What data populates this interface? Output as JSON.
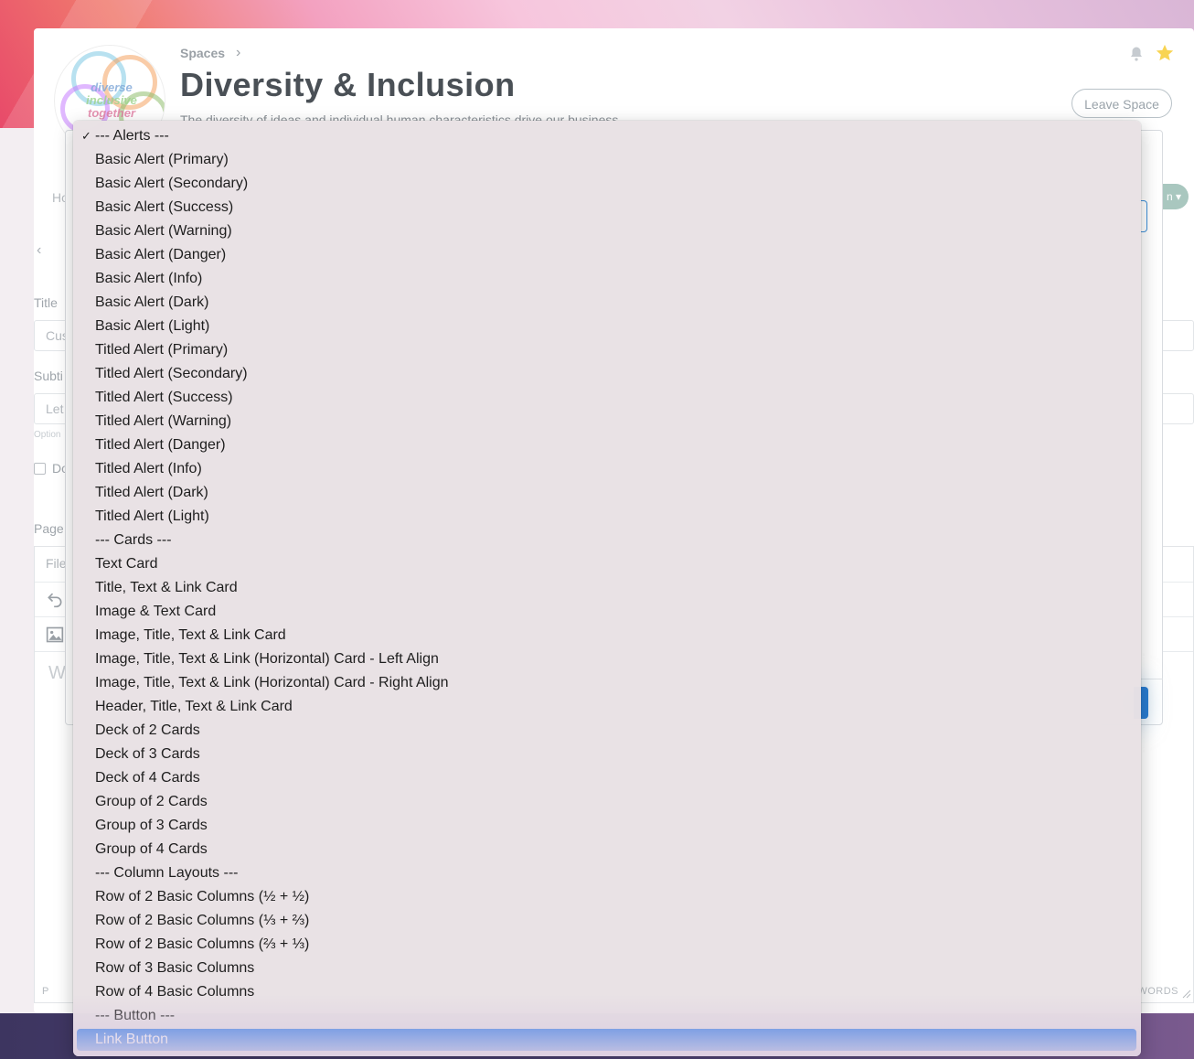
{
  "space": {
    "breadcrumb": "Spaces",
    "title": "Diversity & Inclusion",
    "description": "The diversity of ideas and individual human characteristics drive our business",
    "leave_button": "Leave Space",
    "logo_words": [
      "diverse",
      "inclusive",
      "together"
    ]
  },
  "nav": {
    "home_stub": "Ho",
    "pill_stub": "n ▾"
  },
  "form": {
    "title_label": "Title",
    "title_value": "Cus",
    "subtitle_label": "Subti",
    "subtitle_value": "Let",
    "optional_note": "Option",
    "checkbox_label": "Do",
    "page_label": "Page"
  },
  "editor": {
    "file_menu": "File",
    "placeholder": "W",
    "status_path": "P",
    "words_label": "WORDS"
  },
  "dropdown": {
    "checked_index": 0,
    "selected_index": 38,
    "options": [
      "--- Alerts ---",
      "Basic Alert (Primary)",
      "Basic Alert (Secondary)",
      "Basic Alert (Success)",
      "Basic Alert (Warning)",
      "Basic Alert (Danger)",
      "Basic Alert (Info)",
      "Basic Alert (Dark)",
      "Basic Alert (Light)",
      "Titled Alert (Primary)",
      "Titled Alert (Secondary)",
      "Titled Alert (Success)",
      "Titled Alert (Warning)",
      "Titled Alert (Danger)",
      "Titled Alert (Info)",
      "Titled Alert (Dark)",
      "Titled Alert (Light)",
      "--- Cards ---",
      "Text Card",
      "Title, Text & Link Card",
      "Image & Text Card",
      "Image, Title, Text & Link Card",
      "Image, Title, Text & Link (Horizontal) Card - Left Align",
      "Image, Title, Text & Link (Horizontal) Card - Right Align",
      "Header, Title, Text & Link Card",
      "Deck of 2 Cards",
      "Deck of 3 Cards",
      "Deck of 4 Cards",
      "Group of 2 Cards",
      "Group of 3 Cards",
      "Group of 4 Cards",
      "--- Column Layouts ---",
      "Row of 2 Basic Columns (½ + ½)",
      "Row of 2 Basic Columns (⅓ + ⅔)",
      "Row of 2 Basic Columns (⅔ + ⅓)",
      "Row of 3 Basic Columns",
      "Row of 4 Basic Columns",
      "--- Button ---",
      "Link Button"
    ]
  },
  "colors": {
    "selected_option": "#1f72e8",
    "dropdown_bg": "#e9e1e4",
    "star": "#f5c518"
  },
  "icons": [
    "bell-icon",
    "star-icon",
    "chevron-right-icon",
    "chevron-left-icon",
    "undo-icon",
    "image-icon",
    "checkmark-icon",
    "resize-icon"
  ]
}
